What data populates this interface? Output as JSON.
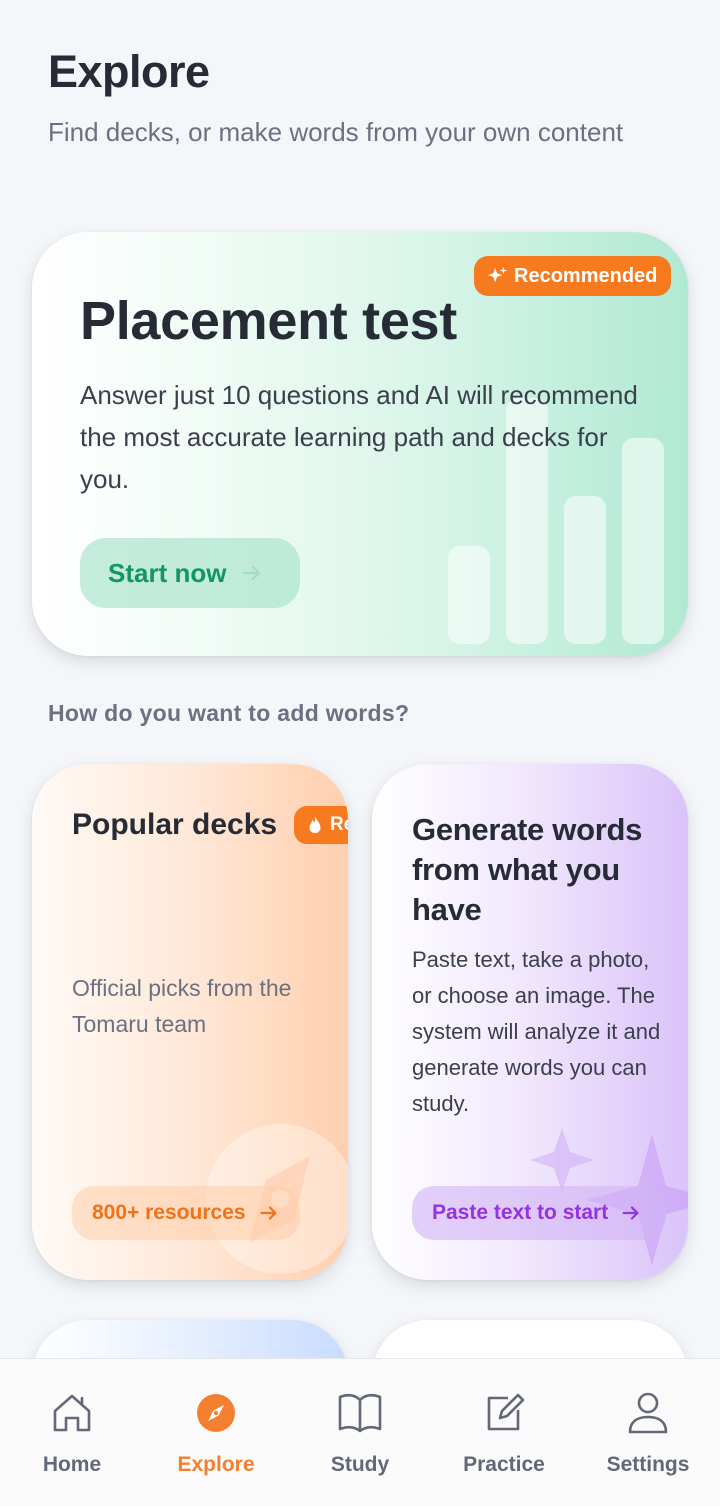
{
  "header": {
    "title": "Explore",
    "subtitle": "Find decks, or make words from your own content"
  },
  "placement": {
    "badge": "Recommended",
    "title": "Placement test",
    "description": "Answer just 10 questions and AI will recommend the most accurate learning path and decks for you.",
    "button_label": "Start now"
  },
  "section": {
    "heading": "How do you want to add words?"
  },
  "popular": {
    "title": "Popular decks",
    "badge": "Recommended",
    "description": "Official picks from the Tomaru team",
    "button_label": "800+ resources"
  },
  "generate": {
    "title": "Generate words from what you have",
    "description": "Paste text, take a photo, or choose an image. The system will analyze it and generate words you can study.",
    "button_label": "Paste text to start"
  },
  "tabbar": {
    "active": "Explore",
    "items": [
      {
        "label": "Home",
        "icon": "home-icon"
      },
      {
        "label": "Explore",
        "icon": "compass-icon"
      },
      {
        "label": "Study",
        "icon": "book-icon"
      },
      {
        "label": "Practice",
        "icon": "edit-icon"
      },
      {
        "label": "Settings",
        "icon": "user-icon"
      }
    ]
  },
  "colors": {
    "accent_orange": "#f77a1f",
    "green": "#149565",
    "purple": "#9434e0",
    "text_dark": "#262b36",
    "text_muted": "#6b7180"
  }
}
